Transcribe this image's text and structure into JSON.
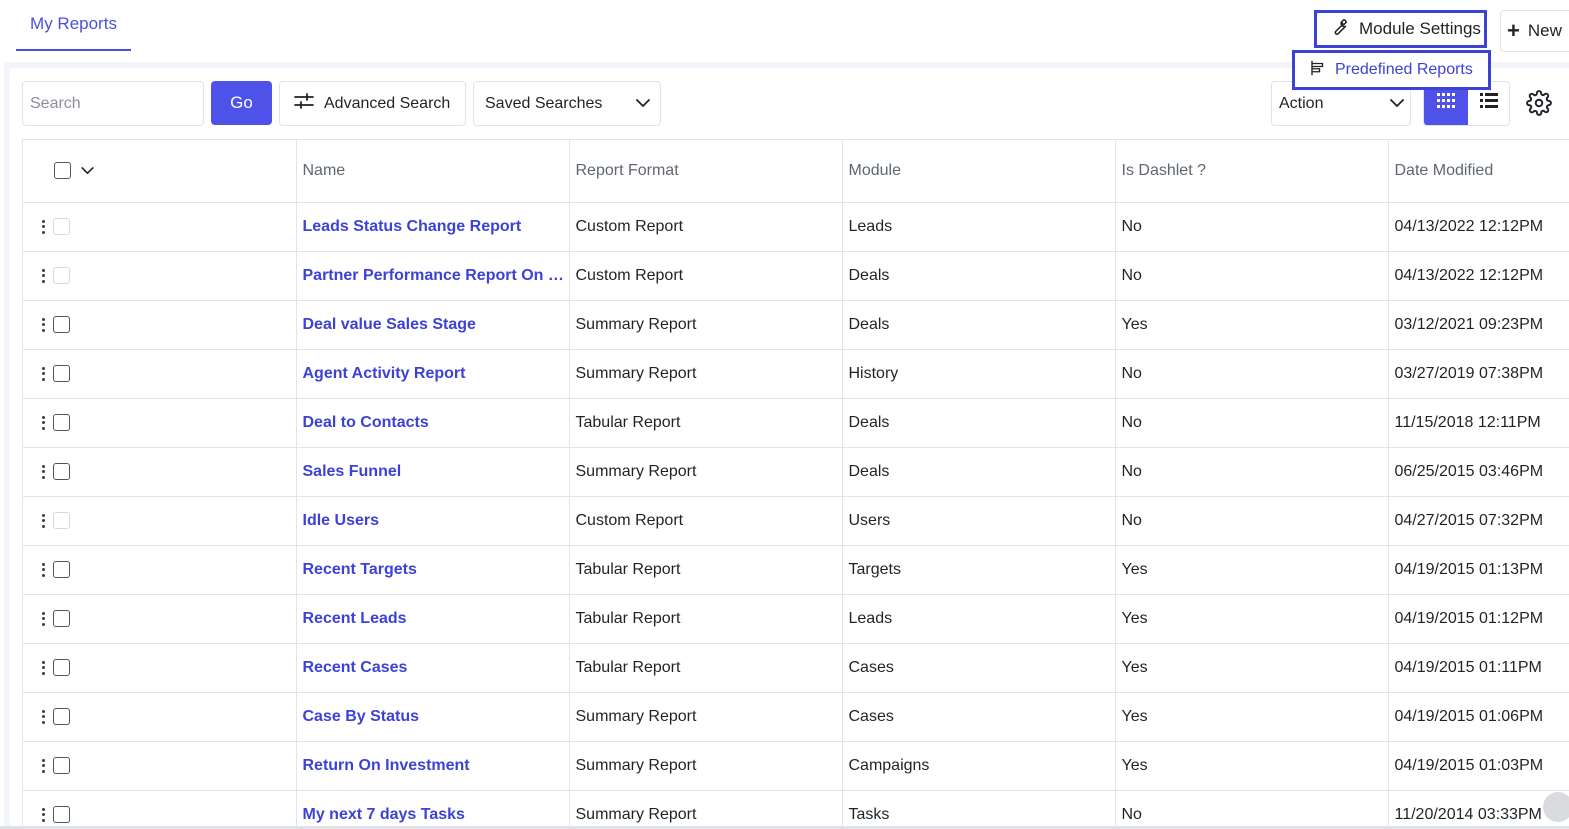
{
  "header": {
    "tab_label": "My Reports",
    "module_settings_label": "Module Settings",
    "new_label": "New",
    "predefined_reports_label": "Predefined Reports"
  },
  "toolbar": {
    "search_placeholder": "Search",
    "go_label": "Go",
    "advanced_search_label": "Advanced Search",
    "saved_searches_label": "Saved Searches",
    "action_label": "Action"
  },
  "colors": {
    "accent": "#4e52e8",
    "link": "#3d42d6",
    "border": "#e3e5ea"
  },
  "icons": {
    "module_settings": "wrench-icon",
    "new": "plus-icon",
    "predefined": "report-list-icon",
    "advanced": "sliders-icon",
    "dropdown": "chevron-down-icon",
    "grid_view": "grid-view-icon",
    "list_view": "list-view-icon",
    "settings": "gear-icon"
  },
  "table": {
    "columns": [
      "Name",
      "Report Format",
      "Module",
      "Is Dashlet ?",
      "Date Modified"
    ],
    "rows": [
      {
        "name": "Leads Status Change Report",
        "format": "Custom Report",
        "module": "Leads",
        "dashlet": "No",
        "date": "04/13/2022 12:12PM",
        "checkbox_disabled": true
      },
      {
        "name": "Partner Performance Report On Deals",
        "format": "Custom Report",
        "module": "Deals",
        "dashlet": "No",
        "date": "04/13/2022 12:12PM",
        "checkbox_disabled": true
      },
      {
        "name": "Deal value Sales Stage",
        "format": "Summary Report",
        "module": "Deals",
        "dashlet": "Yes",
        "date": "03/12/2021 09:23PM",
        "checkbox_disabled": false
      },
      {
        "name": "Agent Activity Report",
        "format": "Summary Report",
        "module": "History",
        "dashlet": "No",
        "date": "03/27/2019 07:38PM",
        "checkbox_disabled": false
      },
      {
        "name": "Deal to Contacts",
        "format": "Tabular Report",
        "module": "Deals",
        "dashlet": "No",
        "date": "11/15/2018 12:11PM",
        "checkbox_disabled": false
      },
      {
        "name": "Sales Funnel",
        "format": "Summary Report",
        "module": "Deals",
        "dashlet": "No",
        "date": "06/25/2015 03:46PM",
        "checkbox_disabled": false
      },
      {
        "name": "Idle Users",
        "format": "Custom Report",
        "module": "Users",
        "dashlet": "No",
        "date": "04/27/2015 07:32PM",
        "checkbox_disabled": true
      },
      {
        "name": "Recent Targets",
        "format": "Tabular Report",
        "module": "Targets",
        "dashlet": "Yes",
        "date": "04/19/2015 01:13PM",
        "checkbox_disabled": false
      },
      {
        "name": "Recent Leads",
        "format": "Tabular Report",
        "module": "Leads",
        "dashlet": "Yes",
        "date": "04/19/2015 01:12PM",
        "checkbox_disabled": false
      },
      {
        "name": "Recent Cases",
        "format": "Tabular Report",
        "module": "Cases",
        "dashlet": "Yes",
        "date": "04/19/2015 01:11PM",
        "checkbox_disabled": false
      },
      {
        "name": "Case By Status",
        "format": "Summary Report",
        "module": "Cases",
        "dashlet": "Yes",
        "date": "04/19/2015 01:06PM",
        "checkbox_disabled": false
      },
      {
        "name": "Return On Investment",
        "format": "Summary Report",
        "module": "Campaigns",
        "dashlet": "Yes",
        "date": "04/19/2015 01:03PM",
        "checkbox_disabled": false
      },
      {
        "name": "My next 7 days Tasks",
        "format": "Summary Report",
        "module": "Tasks",
        "dashlet": "No",
        "date": "11/20/2014 03:33PM",
        "checkbox_disabled": false
      }
    ]
  }
}
